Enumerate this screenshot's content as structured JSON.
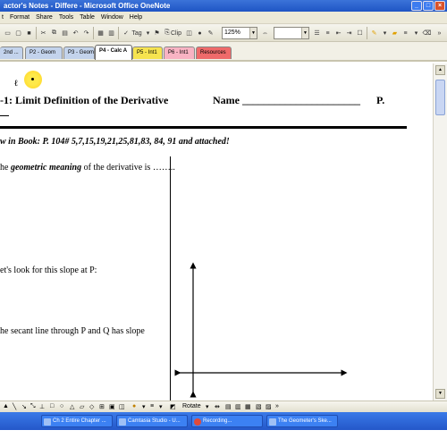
{
  "window": {
    "title": "actor's Notes - Differe - Microsoft Office OneNote"
  },
  "menu": {
    "items": [
      "t",
      "Format",
      "Share",
      "Tools",
      "Table",
      "Window",
      "Help"
    ]
  },
  "toolbar": {
    "tag_label": "Tag",
    "clip_label": "Clip",
    "zoom": "125%"
  },
  "tabs": [
    {
      "label": "2nd ...",
      "style": "blue"
    },
    {
      "label": "P2 - Geom",
      "style": "blue"
    },
    {
      "label": "P3 - Geom",
      "style": "blue"
    },
    {
      "label": "P4 - Calc A",
      "style": "active"
    },
    {
      "label": "P5 - Int1",
      "style": "yellow"
    },
    {
      "label": "P6 - Int1",
      "style": "pink"
    },
    {
      "label": "Resources",
      "style": "red"
    }
  ],
  "note": {
    "heading": "-1:   Limit Definition of the Derivative",
    "name_field": "Name ______________________",
    "period_field": "P.",
    "homework": "w in Book:  P. 104# 5,7,15,19,21,25,81,83, 84, 91 and attached!",
    "q1_prefix": "he ",
    "q1_emphasis": "geometric meaning",
    "q1_suffix": " of the derivative is ……..",
    "q2": "et's look for this slope at P:",
    "q3": "he secant line through P and Q has slope"
  },
  "drawbar": {
    "rotate_label": "Rotate"
  },
  "taskbar": {
    "items": [
      "Ch 2 Entire Chapter ...",
      "Camtasia Studio - U...",
      "Recording...",
      "The Geometer's Ske..."
    ]
  }
}
